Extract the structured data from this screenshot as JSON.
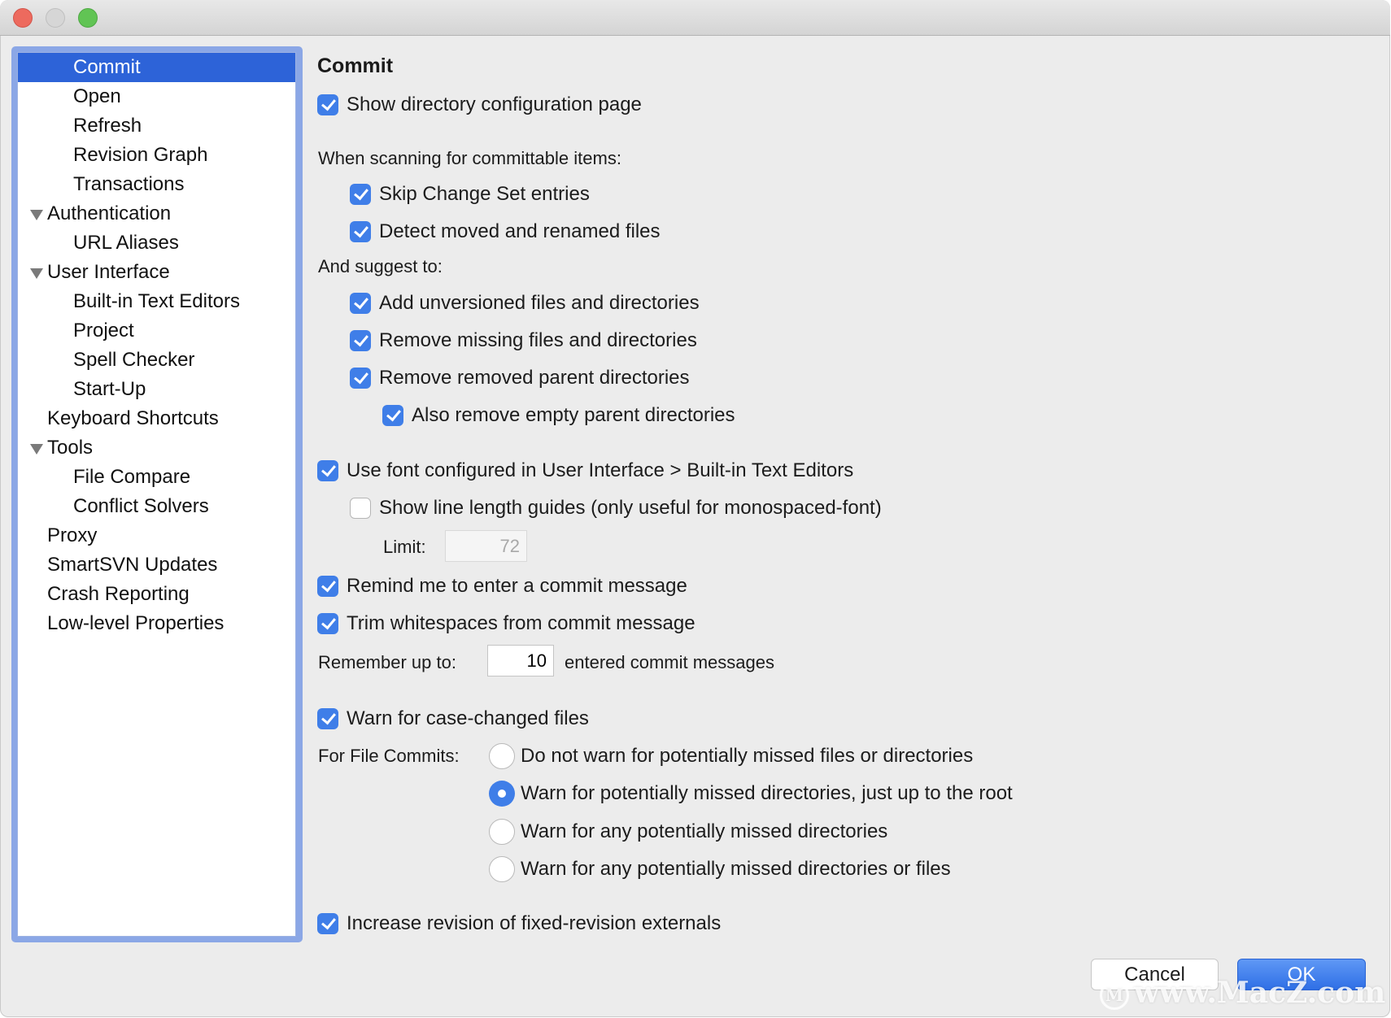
{
  "window": {
    "controls": [
      "close",
      "minimize",
      "zoom"
    ]
  },
  "sidebar": {
    "items": [
      {
        "label": "Commit",
        "level": 1,
        "selected": true
      },
      {
        "label": "Open",
        "level": 1
      },
      {
        "label": "Refresh",
        "level": 1
      },
      {
        "label": "Revision Graph",
        "level": 1
      },
      {
        "label": "Transactions",
        "level": 1
      },
      {
        "label": "Authentication",
        "level": 0,
        "expanded": true
      },
      {
        "label": "URL Aliases",
        "level": 1
      },
      {
        "label": "User Interface",
        "level": 0,
        "expanded": true
      },
      {
        "label": "Built-in Text Editors",
        "level": 1
      },
      {
        "label": "Project",
        "level": 1
      },
      {
        "label": "Spell Checker",
        "level": 1
      },
      {
        "label": "Start-Up",
        "level": 1
      },
      {
        "label": "Keyboard Shortcuts",
        "level": 0
      },
      {
        "label": "Tools",
        "level": 0,
        "expanded": true
      },
      {
        "label": "File Compare",
        "level": 1
      },
      {
        "label": "Conflict Solvers",
        "level": 1
      },
      {
        "label": "Proxy",
        "level": 0
      },
      {
        "label": "SmartSVN Updates",
        "level": 0
      },
      {
        "label": "Crash Reporting",
        "level": 0
      },
      {
        "label": "Low-level Properties",
        "level": 0
      }
    ]
  },
  "page": {
    "title": "Commit",
    "show_directory_config": {
      "label": "Show directory configuration page",
      "checked": true
    },
    "scanning_label": "When scanning for committable items:",
    "skip_change_set": {
      "label": "Skip Change Set entries",
      "checked": true
    },
    "detect_moved": {
      "label": "Detect moved and renamed files",
      "checked": true
    },
    "suggest_label": "And suggest to:",
    "add_unversioned": {
      "label": "Add unversioned files and directories",
      "checked": true
    },
    "remove_missing": {
      "label": "Remove missing files and directories",
      "checked": true
    },
    "remove_removed_parents": {
      "label": "Remove removed parent directories",
      "checked": true
    },
    "also_remove_empty": {
      "label": "Also remove empty parent directories",
      "checked": true
    },
    "use_font": {
      "label": "Use font configured in User Interface > Built-in Text Editors",
      "checked": true
    },
    "show_line_guides": {
      "label": "Show line length guides (only useful for monospaced-font)",
      "checked": false
    },
    "limit": {
      "label": "Limit:",
      "value": "72",
      "disabled": true
    },
    "remind_message": {
      "label": "Remind me to enter a commit message",
      "checked": true
    },
    "trim_whitespace": {
      "label": "Trim whitespaces from commit message",
      "checked": true
    },
    "remember": {
      "label_before": "Remember up to:",
      "value": "10",
      "label_after": "entered commit messages"
    },
    "warn_case_changed": {
      "label": "Warn for case-changed files",
      "checked": true
    },
    "file_commits": {
      "label": "For File Commits:",
      "options": [
        {
          "label": "Do not warn for potentially missed files or directories",
          "selected": false
        },
        {
          "label": "Warn for potentially missed directories, just up to the root",
          "selected": true
        },
        {
          "label": "Warn for any potentially missed directories",
          "selected": false
        },
        {
          "label": "Warn for any potentially missed directories or files",
          "selected": false
        }
      ]
    },
    "increase_revision": {
      "label": "Increase revision of fixed-revision externals",
      "checked": true
    }
  },
  "buttons": {
    "cancel": "Cancel",
    "ok": "OK"
  },
  "watermark": {
    "logo": "M",
    "text": "www.MacZ.com"
  },
  "colors": {
    "accent": "#3f7ee8",
    "selection": "#2d63d8",
    "focus_ring": "#8ba7e6",
    "window_bg": "#ececec"
  }
}
